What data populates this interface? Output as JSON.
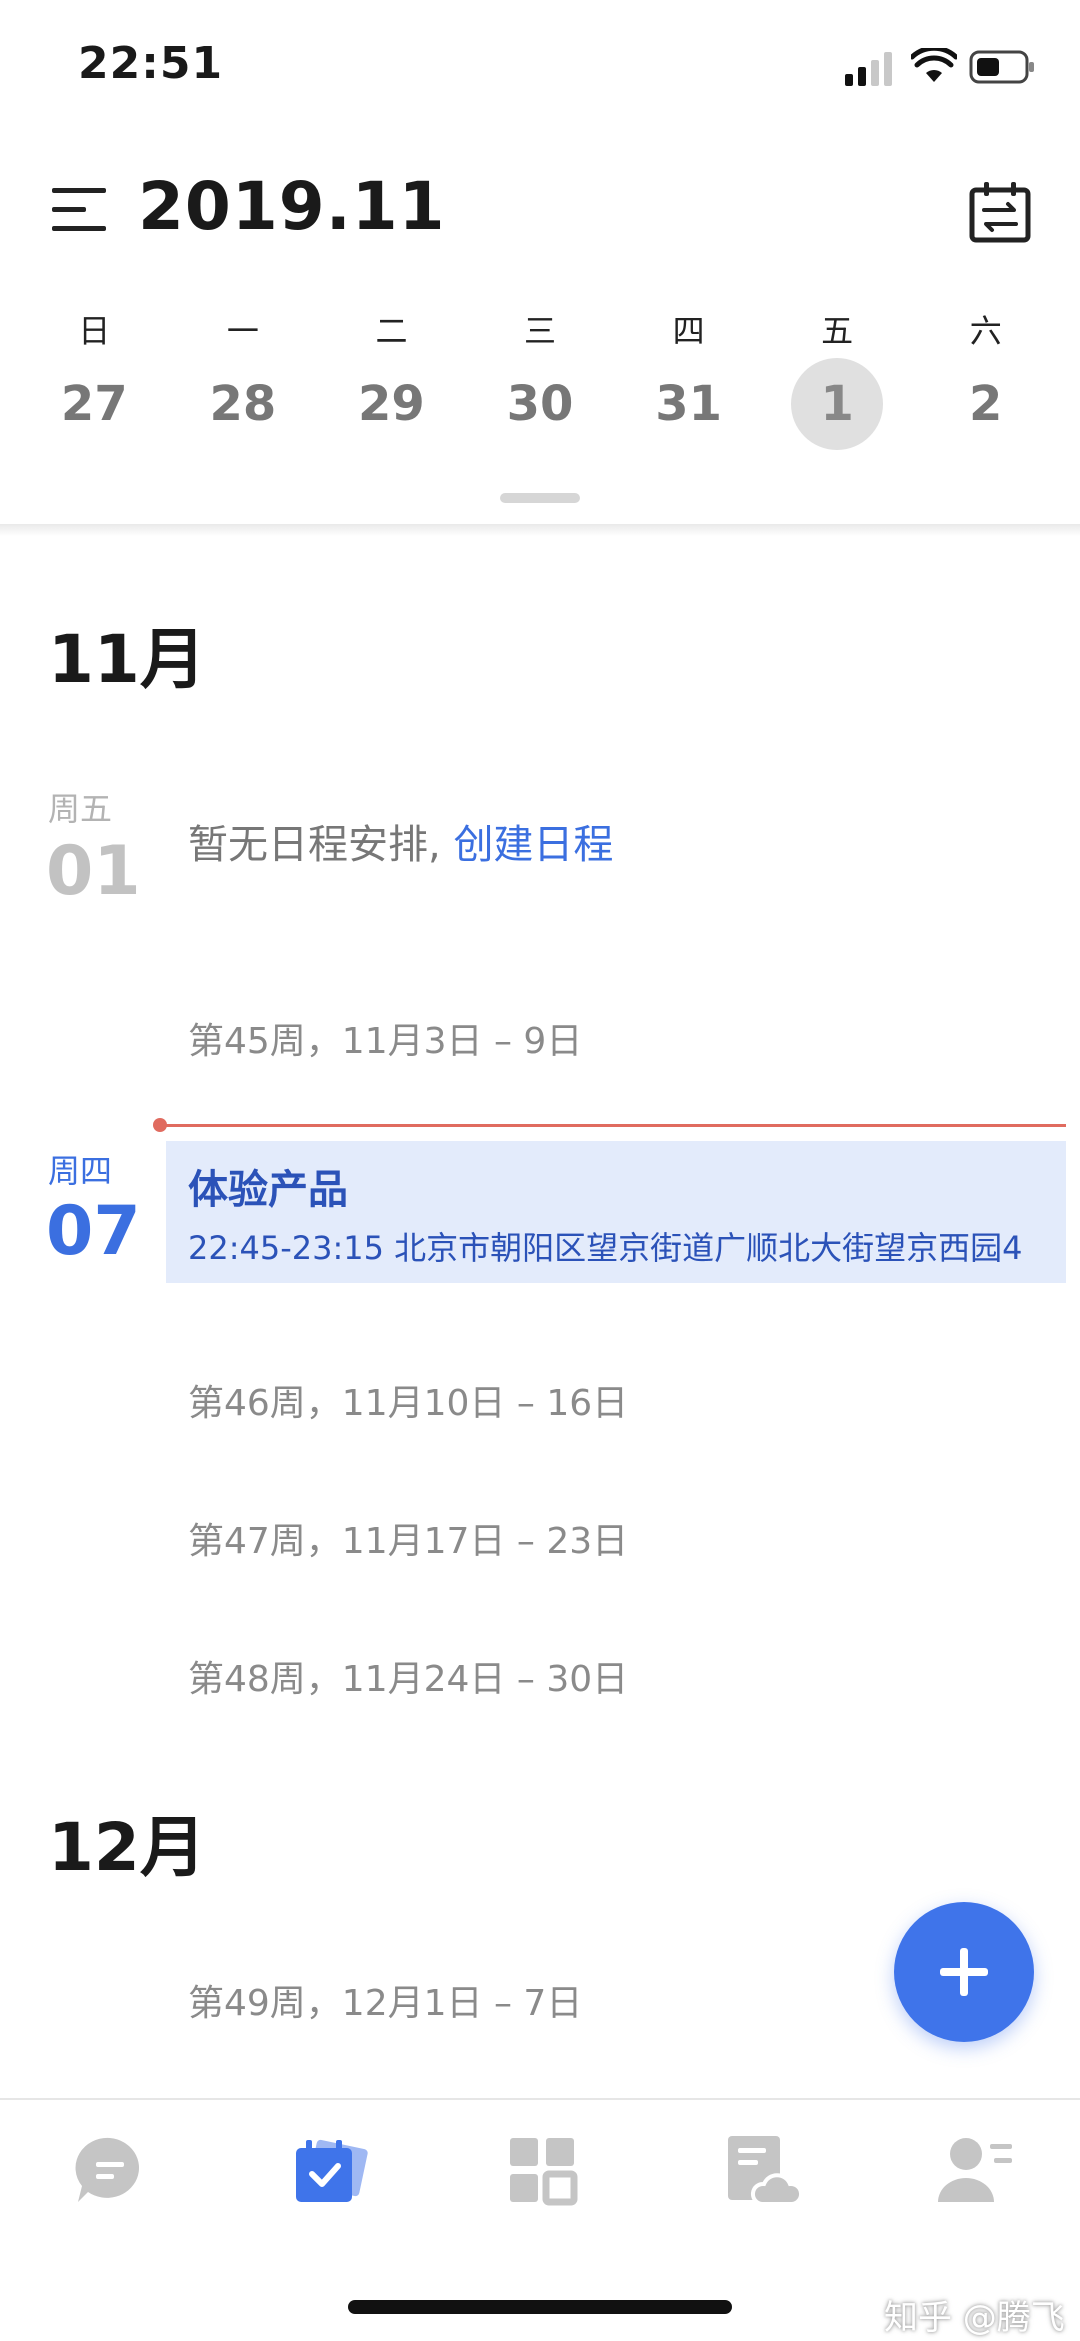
{
  "status_bar": {
    "time": "22:51"
  },
  "header": {
    "title": "2019.11"
  },
  "week_strip": {
    "days": [
      {
        "weekday": "日",
        "day": "27",
        "selected": false
      },
      {
        "weekday": "一",
        "day": "28",
        "selected": false
      },
      {
        "weekday": "二",
        "day": "29",
        "selected": false
      },
      {
        "weekday": "三",
        "day": "30",
        "selected": false
      },
      {
        "weekday": "四",
        "day": "31",
        "selected": false
      },
      {
        "weekday": "五",
        "day": "1",
        "selected": true
      },
      {
        "weekday": "六",
        "day": "2",
        "selected": false
      }
    ]
  },
  "agenda": {
    "nov": {
      "month": "11月",
      "day1": {
        "weekday": "周五",
        "date": "01",
        "empty_text": "暂无日程安排, ",
        "create_link": "创建日程"
      },
      "week45": "第45周，11月3日 – 9日",
      "today": {
        "weekday": "周四",
        "date": "07"
      },
      "event": {
        "title": "体验产品",
        "detail": "22:45-23:15  北京市朝阳区望京街道广顺北大街望京西园4"
      },
      "week46": "第46周，11月10日 – 16日",
      "week47": "第47周，11月17日 – 23日",
      "week48": "第48周，11月24日 – 30日"
    },
    "dec": {
      "month": "12月",
      "week49": "第49周，12月1日 – 7日"
    }
  },
  "watermark": "知乎 @腾飞",
  "colors": {
    "accent": "#3f74ea",
    "now_line": "#e06b5f",
    "event_bg": "#e3ebfb"
  },
  "nav": {
    "items": [
      {
        "icon": "chat-icon",
        "active": false
      },
      {
        "icon": "calendar-check-icon",
        "active": true
      },
      {
        "icon": "apps-grid-icon",
        "active": false
      },
      {
        "icon": "cloud-doc-icon",
        "active": false
      },
      {
        "icon": "contacts-icon",
        "active": false
      }
    ]
  }
}
